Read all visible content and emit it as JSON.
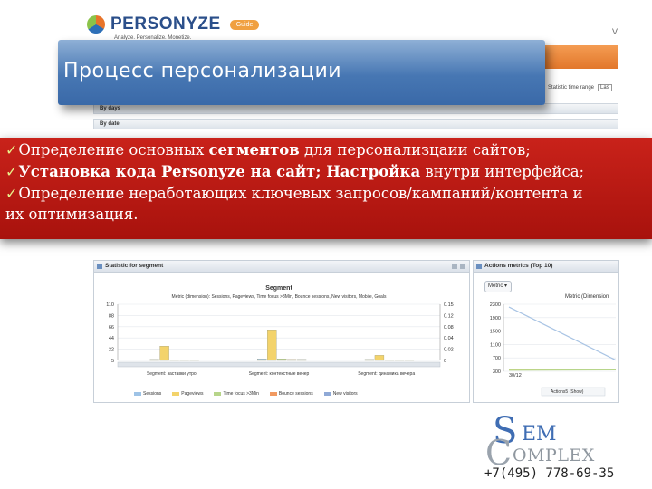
{
  "slide": {
    "title": "Процесс персонализации",
    "bullets": [
      {
        "check": "✓",
        "parts": [
          "Определение основных ",
          "сегментов",
          " для персонализцаии сайтов;"
        ]
      },
      {
        "check": "✓",
        "parts": [
          "Установка кода Personyze на сайт; Настройка",
          " внутри интерфейса;"
        ]
      },
      {
        "check": "✓",
        "parts": [
          "Определение неработающих ключевых запросов/кампаний/контента и"
        ]
      }
    ],
    "bullet_continuation": "их оптимизация.",
    "phone": "+7(495) 778-69-35"
  },
  "company_logo": {
    "s": "S",
    "em": "EM",
    "c": "C",
    "omplex": "OMPLEX"
  },
  "app": {
    "logo_text": "PERSONYZE",
    "logo_tagline": "Analyze. Personalize. Monetize.",
    "logo_badge": "Guide",
    "corner_letter": "V",
    "stat_range_label": "Statistic time range",
    "stat_range_value": "Las",
    "rows": [
      "By days",
      "By date"
    ],
    "segment_panel_title": "Statistic for segment",
    "actions_panel_title": "Actions metrics (Top 10)",
    "metric_select": "Metric ▾",
    "actions_metric_label": "Metric (Dimension",
    "segment_legend": [
      "Sessions",
      "Pageviews",
      "Time focus >3Min",
      "Bounce sessions",
      "New visitors"
    ],
    "accent_color": "#e2772b",
    "banner_color": "#4777b3",
    "bullet_box_color": "#b8180f"
  },
  "chart_data": [
    {
      "type": "bar",
      "title": "Segment",
      "subtitle": "Metric (dimension): Sessions, Pageviews, Time focus >3Min, Bounce sessions, New visitors, Mobile, Goals",
      "y_left_ticks": [
        "110",
        "88",
        "66",
        "44",
        "22",
        "5"
      ],
      "y_right_ticks": [
        "0.15",
        "0.12",
        "0.08",
        "0.04",
        "0.02",
        "0"
      ],
      "x_labels": [
        "Segment: заставки утро",
        "Segment: контекстные вечер",
        "Segment: динамика вечера"
      ],
      "series": [
        {
          "name": "Sessions",
          "color": "#9ec3e6",
          "values": [
            2,
            3,
            2
          ]
        },
        {
          "name": "Pageviews",
          "color": "#f3d36b",
          "values": [
            28,
            60,
            10
          ]
        },
        {
          "name": "Time focus >3Min",
          "color": "#b7d58a",
          "values": [
            1,
            3,
            1
          ]
        },
        {
          "name": "Bounce sessions",
          "color": "#f19a61",
          "values": [
            1,
            2,
            1
          ]
        },
        {
          "name": "New visitors",
          "color": "#8fa9d6",
          "values": [
            1,
            2,
            1
          ]
        }
      ],
      "ylim": [
        0,
        110
      ],
      "grid": true
    },
    {
      "type": "line",
      "y_ticks": [
        "2300",
        "1900",
        "1500",
        "1100",
        "700",
        "300"
      ],
      "x_tick": "30/12",
      "legend": "Actions5 (Show)",
      "series": [
        {
          "color": "#a9c4e4",
          "values": [
            2300,
            400
          ]
        },
        {
          "color": "#f3d36b",
          "values": [
            60,
            70
          ]
        },
        {
          "color": "#b7d58a",
          "values": [
            40,
            50
          ]
        }
      ],
      "ylim": [
        0,
        2400
      ],
      "grid": true
    }
  ]
}
